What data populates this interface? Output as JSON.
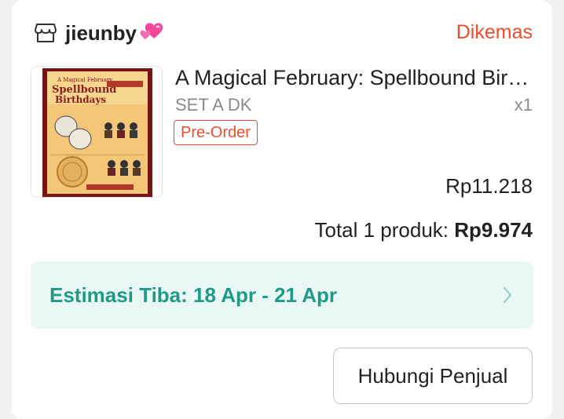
{
  "shop": {
    "name": "jieunby",
    "emoji_icon": "two-hearts",
    "status": "Dikemas"
  },
  "product": {
    "title": "A Magical February: Spellbound Bir…",
    "variant": "SET A DK",
    "quantity": "x1",
    "badge": "Pre-Order",
    "price": "Rp11.218",
    "thumbnail_icon": "product-poster-image"
  },
  "total": {
    "label": "Total 1 produk: ",
    "amount": "Rp9.974"
  },
  "estimate": {
    "text": "Estimasi Tiba: 18 Apr - 21 Apr"
  },
  "actions": {
    "contact_seller": "Hubungi Penjual"
  },
  "colors": {
    "accent": "#ee4d2d",
    "eta_text": "#1e9a86",
    "eta_bg": "#eaf8f5"
  }
}
